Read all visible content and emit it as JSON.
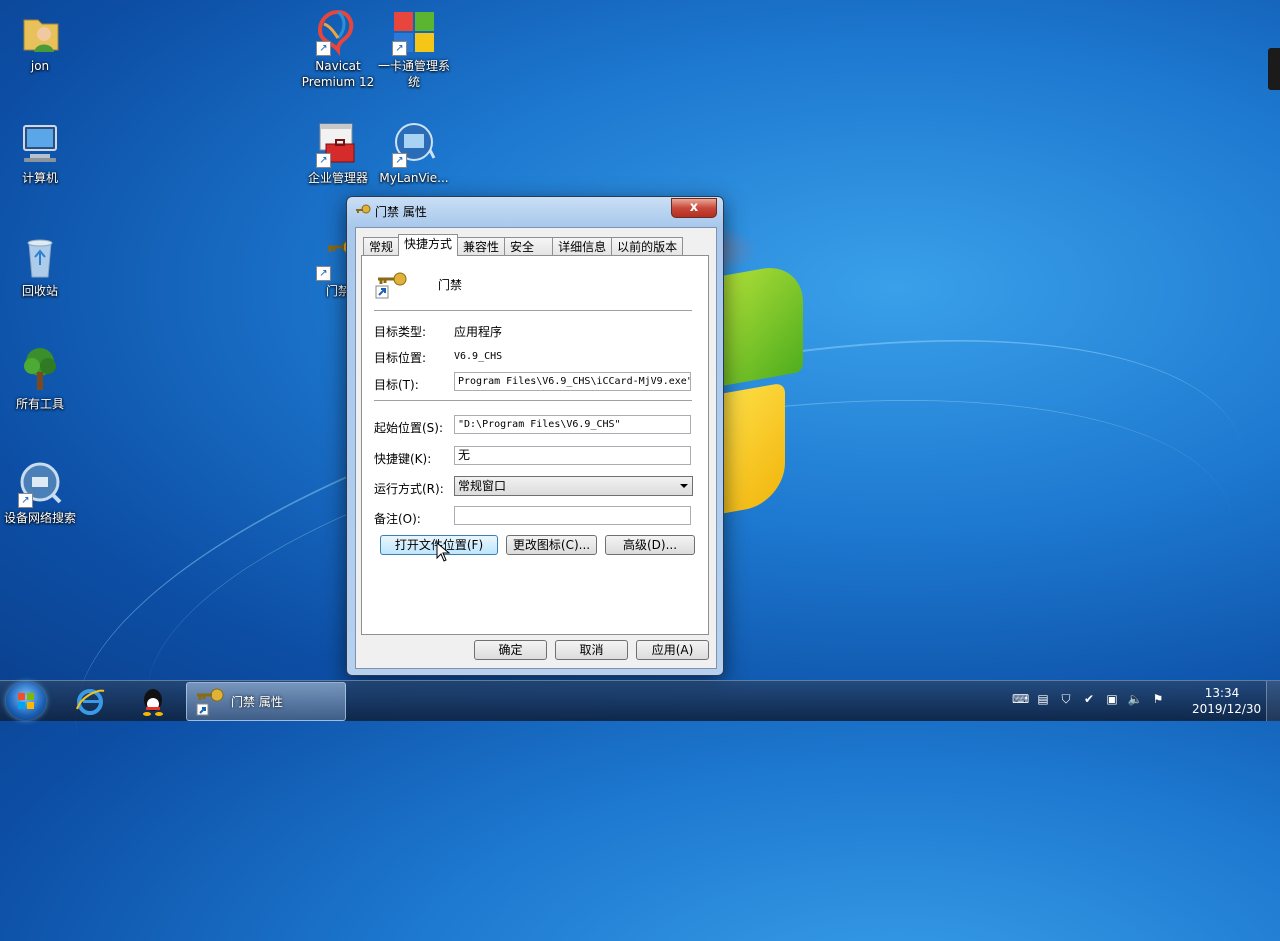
{
  "desktop": {
    "icons": [
      {
        "label": "jon",
        "icon": "user-folder-icon"
      },
      {
        "label": "计算机",
        "icon": "computer-icon"
      },
      {
        "label": "回收站",
        "icon": "recycle-bin-icon"
      },
      {
        "label": "所有工具",
        "icon": "tree-icon"
      },
      {
        "label": "设备网络搜索",
        "icon": "network-search-icon"
      },
      {
        "label": "Navicat Premium 12",
        "icon": "navicat-icon"
      },
      {
        "label": "一卡通管理系统",
        "icon": "card-system-icon"
      },
      {
        "label": "企业管理器",
        "icon": "toolbox-icon"
      },
      {
        "label": "MyLanVie...",
        "icon": "mylanviewer-icon"
      },
      {
        "label": "门禁",
        "icon": "keys-icon"
      }
    ]
  },
  "dialog": {
    "title": "门禁 属性",
    "close": "x",
    "tabs": [
      "常规",
      "快捷方式",
      "兼容性",
      "安全",
      "详细信息",
      "以前的版本"
    ],
    "shortcut_name": "门禁",
    "target_type_label": "目标类型:",
    "target_type_value": "应用程序",
    "target_location_label": "目标位置:",
    "target_location_value": "V6.9_CHS",
    "target_label": "目标(T):",
    "target_value": "Program Files\\V6.9_CHS\\iCCard-MjV9.exe\"",
    "start_in_label": "起始位置(S):",
    "start_in_value": "\"D:\\Program Files\\V6.9_CHS\"",
    "hotkey_label": "快捷键(K):",
    "hotkey_value": "无",
    "run_label": "运行方式(R):",
    "run_value": "常规窗口",
    "comment_label": "备注(O):",
    "comment_value": "",
    "btn_open_location": "打开文件位置(F)",
    "btn_change_icon": "更改图标(C)...",
    "btn_advanced": "高级(D)...",
    "btn_ok": "确定",
    "btn_cancel": "取消",
    "btn_apply": "应用(A)"
  },
  "taskbar": {
    "window_label": "门禁 属性",
    "time": "13:34",
    "date": "2019/12/30"
  }
}
